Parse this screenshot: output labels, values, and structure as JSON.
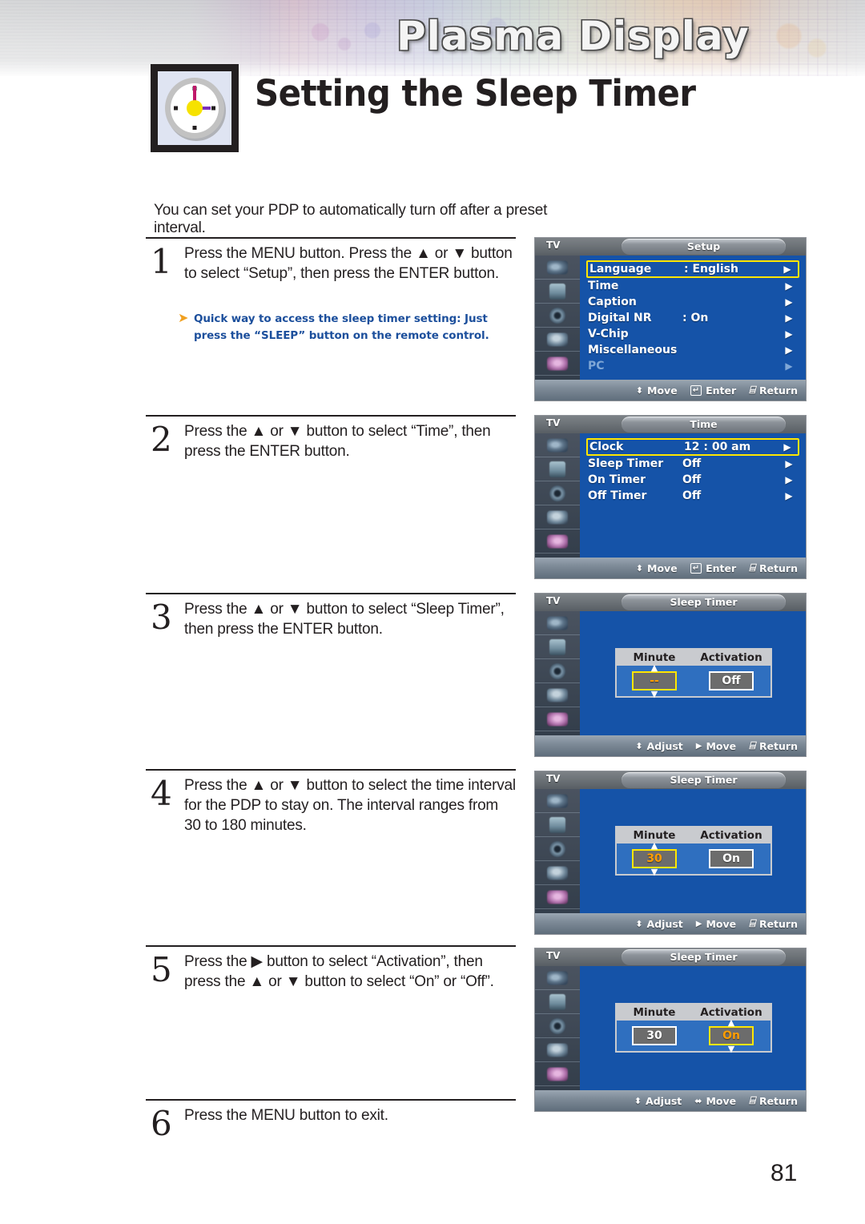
{
  "header": {
    "banner_title": "Plasma Display",
    "page_title": "Setting the Sleep Timer",
    "clock_icon": "clock-icon"
  },
  "intro": "You can set your PDP to automatically turn off after a preset interval.",
  "note": {
    "arrow_icon": "arrow-bullet-icon",
    "text": "Quick way to access the sleep timer setting: Just press the “SLEEP” button on the remote control.",
    "color": "#1c4f9c"
  },
  "steps": [
    {
      "num": "1",
      "text": "Press the MENU button. Press the ▲ or ▼ button to select “Setup”, then press the ENTER button."
    },
    {
      "num": "2",
      "text": "Press the ▲ or ▼ button to select “Time”, then press the ENTER button."
    },
    {
      "num": "3",
      "text": "Press the ▲ or ▼ button to select “Sleep Timer”, then press the ENTER button."
    },
    {
      "num": "4",
      "text": "Press the ▲ or ▼ button to select the time interval for the PDP to stay on. The interval ranges from 30 to 180 minutes."
    },
    {
      "num": "5",
      "text": "Press the ▶ button to select “Activation”, then press the ▲ or ▼ button to select “On” or “Off”."
    },
    {
      "num": "6",
      "text": "Press the MENU button to exit."
    }
  ],
  "osd": {
    "source_label": "TV",
    "highlight_color": "#ffe600",
    "panel_color": "#1553a8",
    "screens": [
      {
        "title": "Setup",
        "rows": [
          {
            "label": "Language",
            "value": ": English",
            "arrow": "▶",
            "selected": true,
            "dim": false
          },
          {
            "label": "Time",
            "value": "",
            "arrow": "▶",
            "selected": false,
            "dim": false
          },
          {
            "label": "Caption",
            "value": "",
            "arrow": "▶",
            "selected": false,
            "dim": false
          },
          {
            "label": "Digital NR",
            "value": ": On",
            "arrow": "▶",
            "selected": false,
            "dim": false
          },
          {
            "label": "V-Chip",
            "value": "",
            "arrow": "▶",
            "selected": false,
            "dim": false
          },
          {
            "label": "Miscellaneous",
            "value": "",
            "arrow": "▶",
            "selected": false,
            "dim": false
          },
          {
            "label": "PC",
            "value": "",
            "arrow": "▶",
            "selected": false,
            "dim": true
          }
        ],
        "hints": [
          {
            "icon": "up-down-arrow-icon",
            "label": "Move"
          },
          {
            "icon": "enter-key-icon",
            "label": "Enter"
          },
          {
            "icon": "return-key-icon",
            "label": "Return"
          }
        ]
      },
      {
        "title": "Time",
        "rows": [
          {
            "label": "Clock",
            "value": "12 : 00 am",
            "arrow": "▶",
            "selected": true,
            "dim": false
          },
          {
            "label": "Sleep Timer",
            "value": "Off",
            "arrow": "▶",
            "selected": false,
            "dim": false
          },
          {
            "label": "On Timer",
            "value": "Off",
            "arrow": "▶",
            "selected": false,
            "dim": false
          },
          {
            "label": "Off Timer",
            "value": "Off",
            "arrow": "▶",
            "selected": false,
            "dim": false
          }
        ],
        "hints": [
          {
            "icon": "up-down-arrow-icon",
            "label": "Move"
          },
          {
            "icon": "enter-key-icon",
            "label": "Enter"
          },
          {
            "icon": "return-key-icon",
            "label": "Return"
          }
        ]
      },
      {
        "title": "Sleep Timer",
        "dialog": {
          "col1_header": "Minute",
          "col2_header": "Activation",
          "minute_value": "--",
          "activation_value": "Off",
          "focused_field": "minute"
        },
        "hints": [
          {
            "icon": "up-down-arrow-icon",
            "label": "Adjust"
          },
          {
            "icon": "right-arrow-icon",
            "label": "Move"
          },
          {
            "icon": "return-key-icon",
            "label": "Return"
          }
        ]
      },
      {
        "title": "Sleep Timer",
        "dialog": {
          "col1_header": "Minute",
          "col2_header": "Activation",
          "minute_value": "30",
          "activation_value": "On",
          "focused_field": "minute"
        },
        "hints": [
          {
            "icon": "up-down-arrow-icon",
            "label": "Adjust"
          },
          {
            "icon": "right-arrow-icon",
            "label": "Move"
          },
          {
            "icon": "return-key-icon",
            "label": "Return"
          }
        ]
      },
      {
        "title": "Sleep Timer",
        "dialog": {
          "col1_header": "Minute",
          "col2_header": "Activation",
          "minute_value": "30",
          "activation_value": "On",
          "focused_field": "activation"
        },
        "hints": [
          {
            "icon": "up-down-arrow-icon",
            "label": "Adjust"
          },
          {
            "icon": "left-right-arrow-icon",
            "label": "Move"
          },
          {
            "icon": "return-key-icon",
            "label": "Return"
          }
        ]
      }
    ]
  },
  "page_number": "81"
}
